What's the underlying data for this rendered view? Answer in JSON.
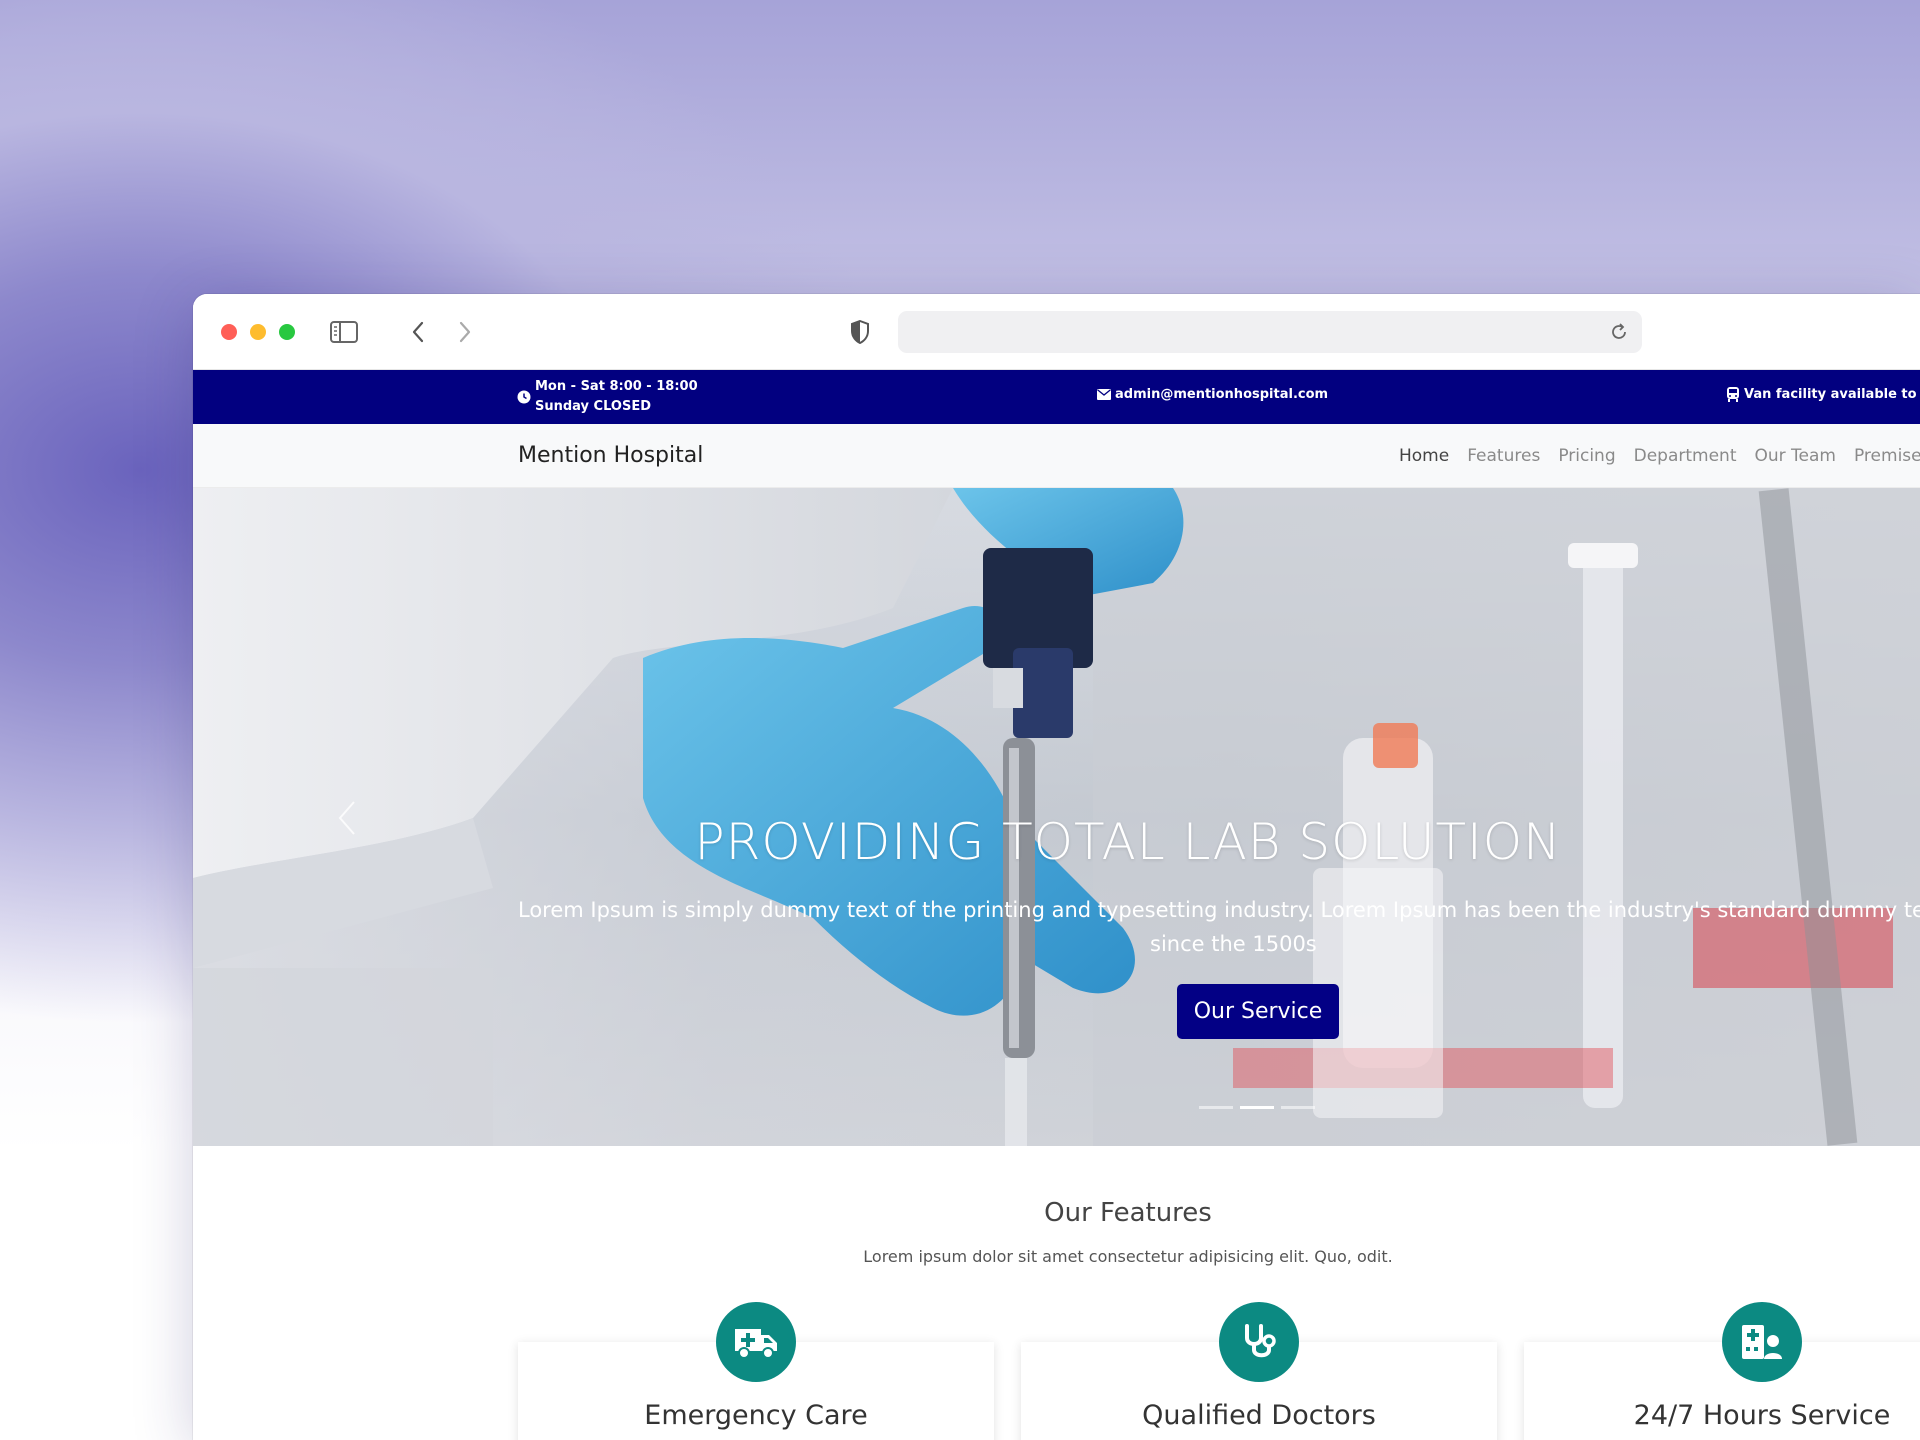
{
  "topbar": {
    "hours_line1": "Mon - Sat 8:00 - 18:00",
    "hours_line2": "Sunday CLOSED",
    "email": "admin@mentionhospital.com",
    "van": "Van facility available to pi",
    "bg_color": "#020080"
  },
  "navbar": {
    "brand": "Mention Hospital",
    "links": [
      "Home",
      "Features",
      "Pricing",
      "Department",
      "Our Team",
      "Premise"
    ]
  },
  "hero": {
    "title": "PROVIDING TOTAL LAB SOLUTION",
    "text_line1": "Lorem Ipsum is simply dummy text of the printing and typesetting industry. Lorem Ipsum has been the industry's standard dummy te",
    "text_line2": "since the 1500s",
    "button": "Our Service",
    "button_color": "#030085",
    "active_slide": 2,
    "slide_count": 3
  },
  "features": {
    "title": "Our Features",
    "subtitle": "Lorem ipsum dolor sit amet consectetur adipisicing elit. Quo, odit.",
    "accent": "#0c8a82",
    "items": [
      {
        "label": "Emergency Care",
        "icon": "ambulance-icon"
      },
      {
        "label": "Qualified Doctors",
        "icon": "stethoscope-icon"
      },
      {
        "label": "24/7 Hours Service",
        "icon": "hospital-user-icon"
      }
    ]
  }
}
